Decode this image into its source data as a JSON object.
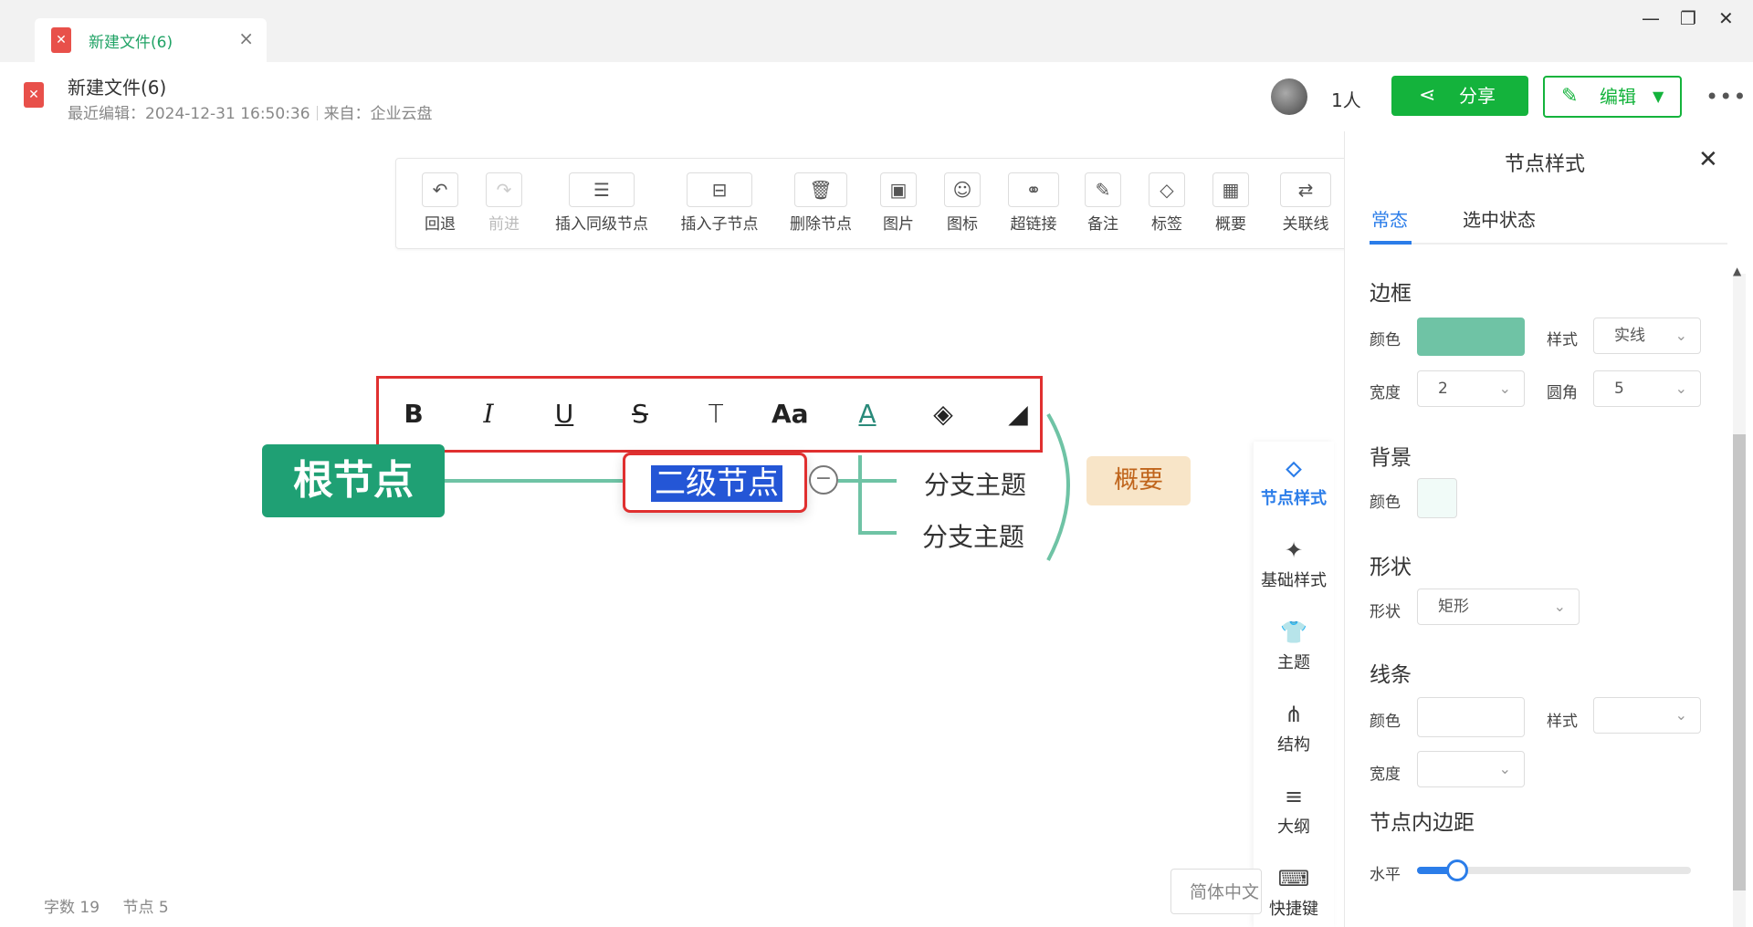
{
  "tab": {
    "title": "新建文件(6)",
    "close": "×"
  },
  "window": {
    "minimize": "—",
    "restore": "❐",
    "close": "✕"
  },
  "doc": {
    "name": "新建文件(6)",
    "last_edit": "最近编辑：2024-12-31 16:50:36",
    "source": "来自：企业云盘"
  },
  "header": {
    "people": "1人",
    "share": "分享",
    "edit": "编辑",
    "more": "•••"
  },
  "toolbar": {
    "items": [
      {
        "label": "回退",
        "icon": "↶"
      },
      {
        "label": "前进",
        "icon": "↷"
      },
      {
        "label": "插入同级节点",
        "icon": "☰"
      },
      {
        "label": "插入子节点",
        "icon": "⊟"
      },
      {
        "label": "删除节点",
        "icon": "🗑"
      },
      {
        "label": "图片",
        "icon": "▣"
      },
      {
        "label": "图标",
        "icon": "☺"
      },
      {
        "label": "超链接",
        "icon": "⚭"
      },
      {
        "label": "备注",
        "icon": "✎"
      },
      {
        "label": "标签",
        "icon": "◇"
      },
      {
        "label": "概要",
        "icon": "▦"
      },
      {
        "label": "关联线",
        "icon": "⇄"
      }
    ]
  },
  "format_bar": {
    "bold": "B",
    "italic": "I",
    "underline": "U",
    "strike": "S",
    "text": "T",
    "font_size": "Aa",
    "font_color": "A",
    "fill": "◈",
    "eraser": "◢"
  },
  "mindmap": {
    "root": "根节点",
    "level2": "二级节点",
    "collapse": "−",
    "branches": [
      "分支主题",
      "分支主题"
    ],
    "summary": "概要"
  },
  "side": {
    "items": [
      {
        "label": "节点样式",
        "icon": "⬦"
      },
      {
        "label": "基础样式",
        "icon": "✦"
      },
      {
        "label": "主题",
        "icon": "👕"
      },
      {
        "label": "结构",
        "icon": "⋔"
      },
      {
        "label": "大纲",
        "icon": "≡"
      },
      {
        "label": "快捷键",
        "icon": "⌨"
      }
    ]
  },
  "status": {
    "words": "字数 19",
    "nodes": "节点 5",
    "lang": "简体中文"
  },
  "panel": {
    "title": "节点样式",
    "close": "✕",
    "tabs": [
      "常态",
      "选中状态"
    ],
    "border": {
      "heading": "边框",
      "color_label": "颜色",
      "color": "#6fc3a5",
      "style_label": "样式",
      "style_value": "实线",
      "width_label": "宽度",
      "width_value": "2",
      "radius_label": "圆角",
      "radius_value": "5"
    },
    "background": {
      "heading": "背景",
      "color_label": "颜色",
      "color": "#f1fbf8"
    },
    "shape": {
      "heading": "形状",
      "label": "形状",
      "value": "矩形"
    },
    "line": {
      "heading": "线条",
      "color_label": "颜色",
      "style_label": "样式",
      "width_label": "宽度"
    },
    "padding": {
      "heading": "节点内边距",
      "horizontal_label": "水平",
      "horizontal_level": 0.12
    }
  },
  "colors": {
    "accent": "#2b7de9",
    "brand_green": "#14b33c",
    "root_node": "#1fa074",
    "selection": "#2456d6",
    "highlight_border": "#e03030",
    "summary_bg": "#f8e5c8"
  }
}
